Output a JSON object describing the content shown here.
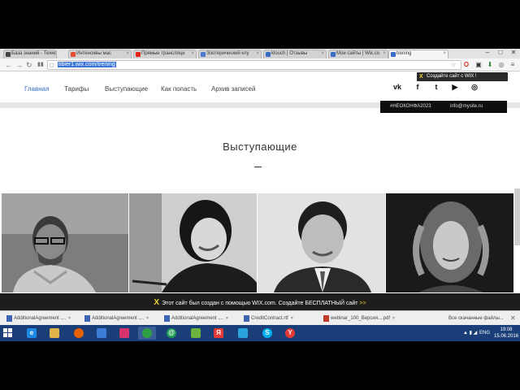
{
  "browser": {
    "tabs": [
      {
        "label": "База знаний - Техно",
        "color": "#444"
      },
      {
        "label": "Интенсивы мас",
        "color": "#e24a32"
      },
      {
        "label": "Прямые трансляци",
        "color": "#e62117"
      },
      {
        "label": "Эзотерический клу",
        "color": "#4a7bd0"
      },
      {
        "label": "klouch | Отзывы",
        "color": "#3b6cc6"
      },
      {
        "label": "Мои сайты | Wix.co",
        "color": "#3b6cc6"
      },
      {
        "label": "trening",
        "color": "#3b6cc6"
      }
    ],
    "url": "tibier1.wix.com/trening",
    "window_controls": [
      "–",
      "□",
      "✕"
    ]
  },
  "site": {
    "nav": [
      {
        "label": "Главная"
      },
      {
        "label": "Тарифы"
      },
      {
        "label": "Выступающие"
      },
      {
        "label": "Как попасть"
      },
      {
        "label": "Архив записей"
      }
    ],
    "social": [
      {
        "icon": "vk-icon",
        "glyph": "vk"
      },
      {
        "icon": "facebook-icon",
        "glyph": "f"
      },
      {
        "icon": "twitter-icon",
        "glyph": "t"
      },
      {
        "icon": "youtube-icon",
        "glyph": "▶"
      },
      {
        "icon": "instagram-icon",
        "glyph": "◎"
      }
    ],
    "promo": "Создайте сайт с WIX !",
    "hashtag": "#НЕОКОНФА2023",
    "email": "info@mysite.ru",
    "section_title": "Выступающие",
    "section_dash": "–",
    "wix_banner": {
      "text": "Этот сайт был создан с помощью WIX.com. Создайте БЕСПЛАТНЫЙ сайт",
      "cta": ">>"
    }
  },
  "downloads": {
    "items": [
      {
        "label": "AdditionalAgreement ....",
        "type": "doc"
      },
      {
        "label": "AdditionalAgreement ....",
        "type": "doc"
      },
      {
        "label": "AdditionalAgreement ....",
        "type": "doc"
      },
      {
        "label": "CreditContract.rtf",
        "type": "doc"
      },
      {
        "label": "webinar_100_Версия....pdf",
        "type": "pdf"
      }
    ],
    "show_all": "Все скачанные файлы...",
    "close": "✕"
  },
  "taskbar": {
    "lang": "ENG",
    "time": "19:08",
    "date": "15.06.2016"
  }
}
